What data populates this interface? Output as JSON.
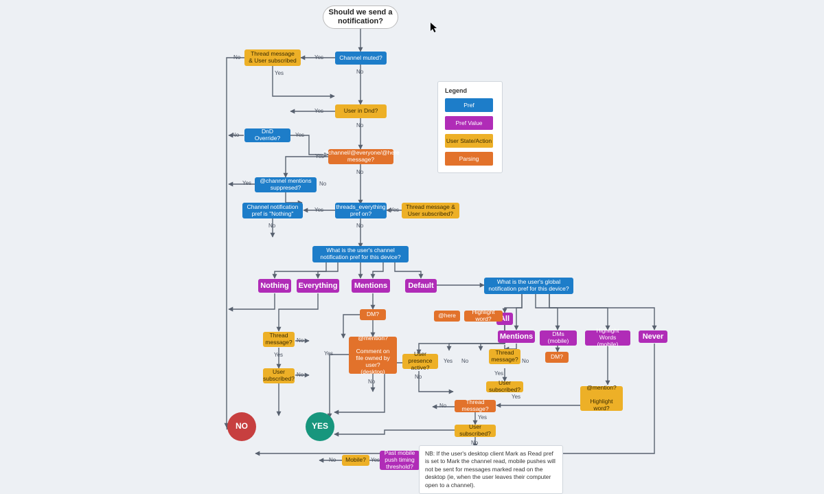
{
  "title": "Should we send a notification?",
  "terminal": {
    "yes": "YES",
    "no": "NO"
  },
  "labels": {
    "yes": "Yes",
    "no": "No"
  },
  "legend": {
    "title": "Legend",
    "items": [
      {
        "name": "Pref",
        "cls": "blue"
      },
      {
        "name": "Pref Value",
        "cls": "magenta"
      },
      {
        "name": "User State/Action",
        "cls": "amber"
      },
      {
        "name": "Parsing",
        "cls": "orange"
      }
    ]
  },
  "note": "NB: If the user's desktop client Mark as Read pref is set to Mark the channel read, mobile pushes will not be sent for messages marked read on the desktop (ie, when the user leaves their computer open to a channel).",
  "nodes": {
    "channel_muted": "Channel muted?",
    "tm_sub_top": "Thread message & User subscribed",
    "user_in_dnd": "User in Dnd?",
    "dnd_override": "DnD Override?",
    "at_channel_msg": "@channel/@everyone/@here message?",
    "at_suppressed": "@channel mentions suppresed?",
    "chan_pref_nothing": "Channel notification pref is \"Nothing\"",
    "threads_everything": "threads_everything pref on?",
    "tm_sub_mid": "Thread message & User subscribed?",
    "chan_pref_device": "What is the user's channel notification pref for this device?",
    "nothing": "Nothing",
    "everything": "Everything",
    "mentions_chan": "Mentions",
    "default": "Default",
    "global_pref_device": "What is the user's global notification pref for this device?",
    "all": "All",
    "mentions_glob": "Mentions",
    "dms_mobile": "DMs (mobile)",
    "highlight_words_m": "Highlight Words (mobile)",
    "never": "Never",
    "dm_q": "DM?",
    "dm_q2": "DM?",
    "at_here": "@here",
    "highlight_word": "Highlight word?",
    "at_mention_block": "@mention?\n\nComment on file owned by user? (desktop)",
    "thread_msg_l": "Thread message?",
    "user_sub_l": "User subscribed?",
    "user_presence": "User presence active?",
    "thread_msg_r": "Thread message?",
    "user_sub_r": "User subscribed?",
    "thread_msg_c": "Thread message?",
    "user_sub_c": "User subscribed?",
    "at_mention_hw": "@mention?\n\nHighlight word?",
    "mobile_q": "Mobile?",
    "past_mobile_thresh": "Past mobile push timing threshold?"
  }
}
